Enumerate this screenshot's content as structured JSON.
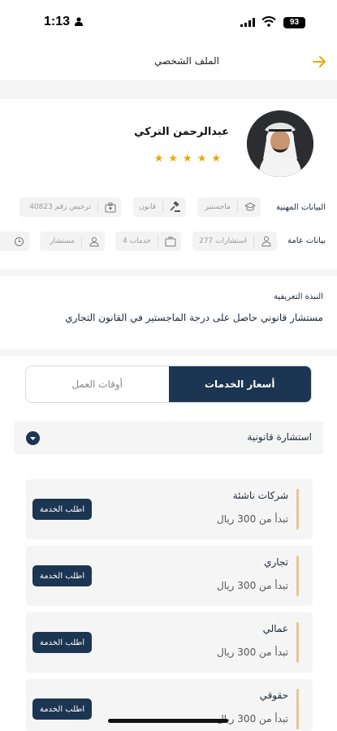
{
  "status_bar": {
    "time": "1:13",
    "battery": "93"
  },
  "header": {
    "title": "الملف الشخصي"
  },
  "profile": {
    "name": "عبدالرحمن التركي",
    "rating_stars": 5,
    "professional_label": "البيانات المهنية",
    "professional_chips": [
      {
        "label": "ماجستير",
        "icon": "graduation-cap-icon"
      },
      {
        "label": "قانون",
        "icon": "gavel-icon"
      },
      {
        "label": "ترخيص رقم 40823",
        "icon": "license-icon"
      }
    ],
    "general_label": "بيانات عامة",
    "general_chips": [
      {
        "label": "277 استشارات",
        "icon": "consultations-icon"
      },
      {
        "label": "4 خدمات",
        "icon": "briefcase-icon"
      },
      {
        "label": "مستشار",
        "icon": "user-icon"
      }
    ]
  },
  "bio": {
    "title": "النبذة التعريفية",
    "text": "مستشار قانوني حاصل على درجة الماجستير في القانون التجاري"
  },
  "tabs": {
    "prices": "أسعار الخدمات",
    "hours": "أوقات العمل",
    "active": "prices"
  },
  "category": {
    "label": "استشارة قانونية"
  },
  "services": [
    {
      "name": "شركات ناشئة",
      "price": "تبدأ من 300 ريال",
      "button": "اطلب الخدمة"
    },
    {
      "name": "تجاري",
      "price": "تبدأ من 300 ريال",
      "button": "اطلب الخدمة"
    },
    {
      "name": "عمالي",
      "price": "تبدأ من 300 ريال",
      "button": "اطلب الخدمة"
    },
    {
      "name": "حقوقي",
      "price": "تبدأ من 300 ريال",
      "button": "اطلب الخدمة"
    }
  ],
  "colors": {
    "primary": "#1c3552",
    "star": "#e8a800",
    "accent": "#e3c88e",
    "back_arrow": "#e8a800"
  }
}
